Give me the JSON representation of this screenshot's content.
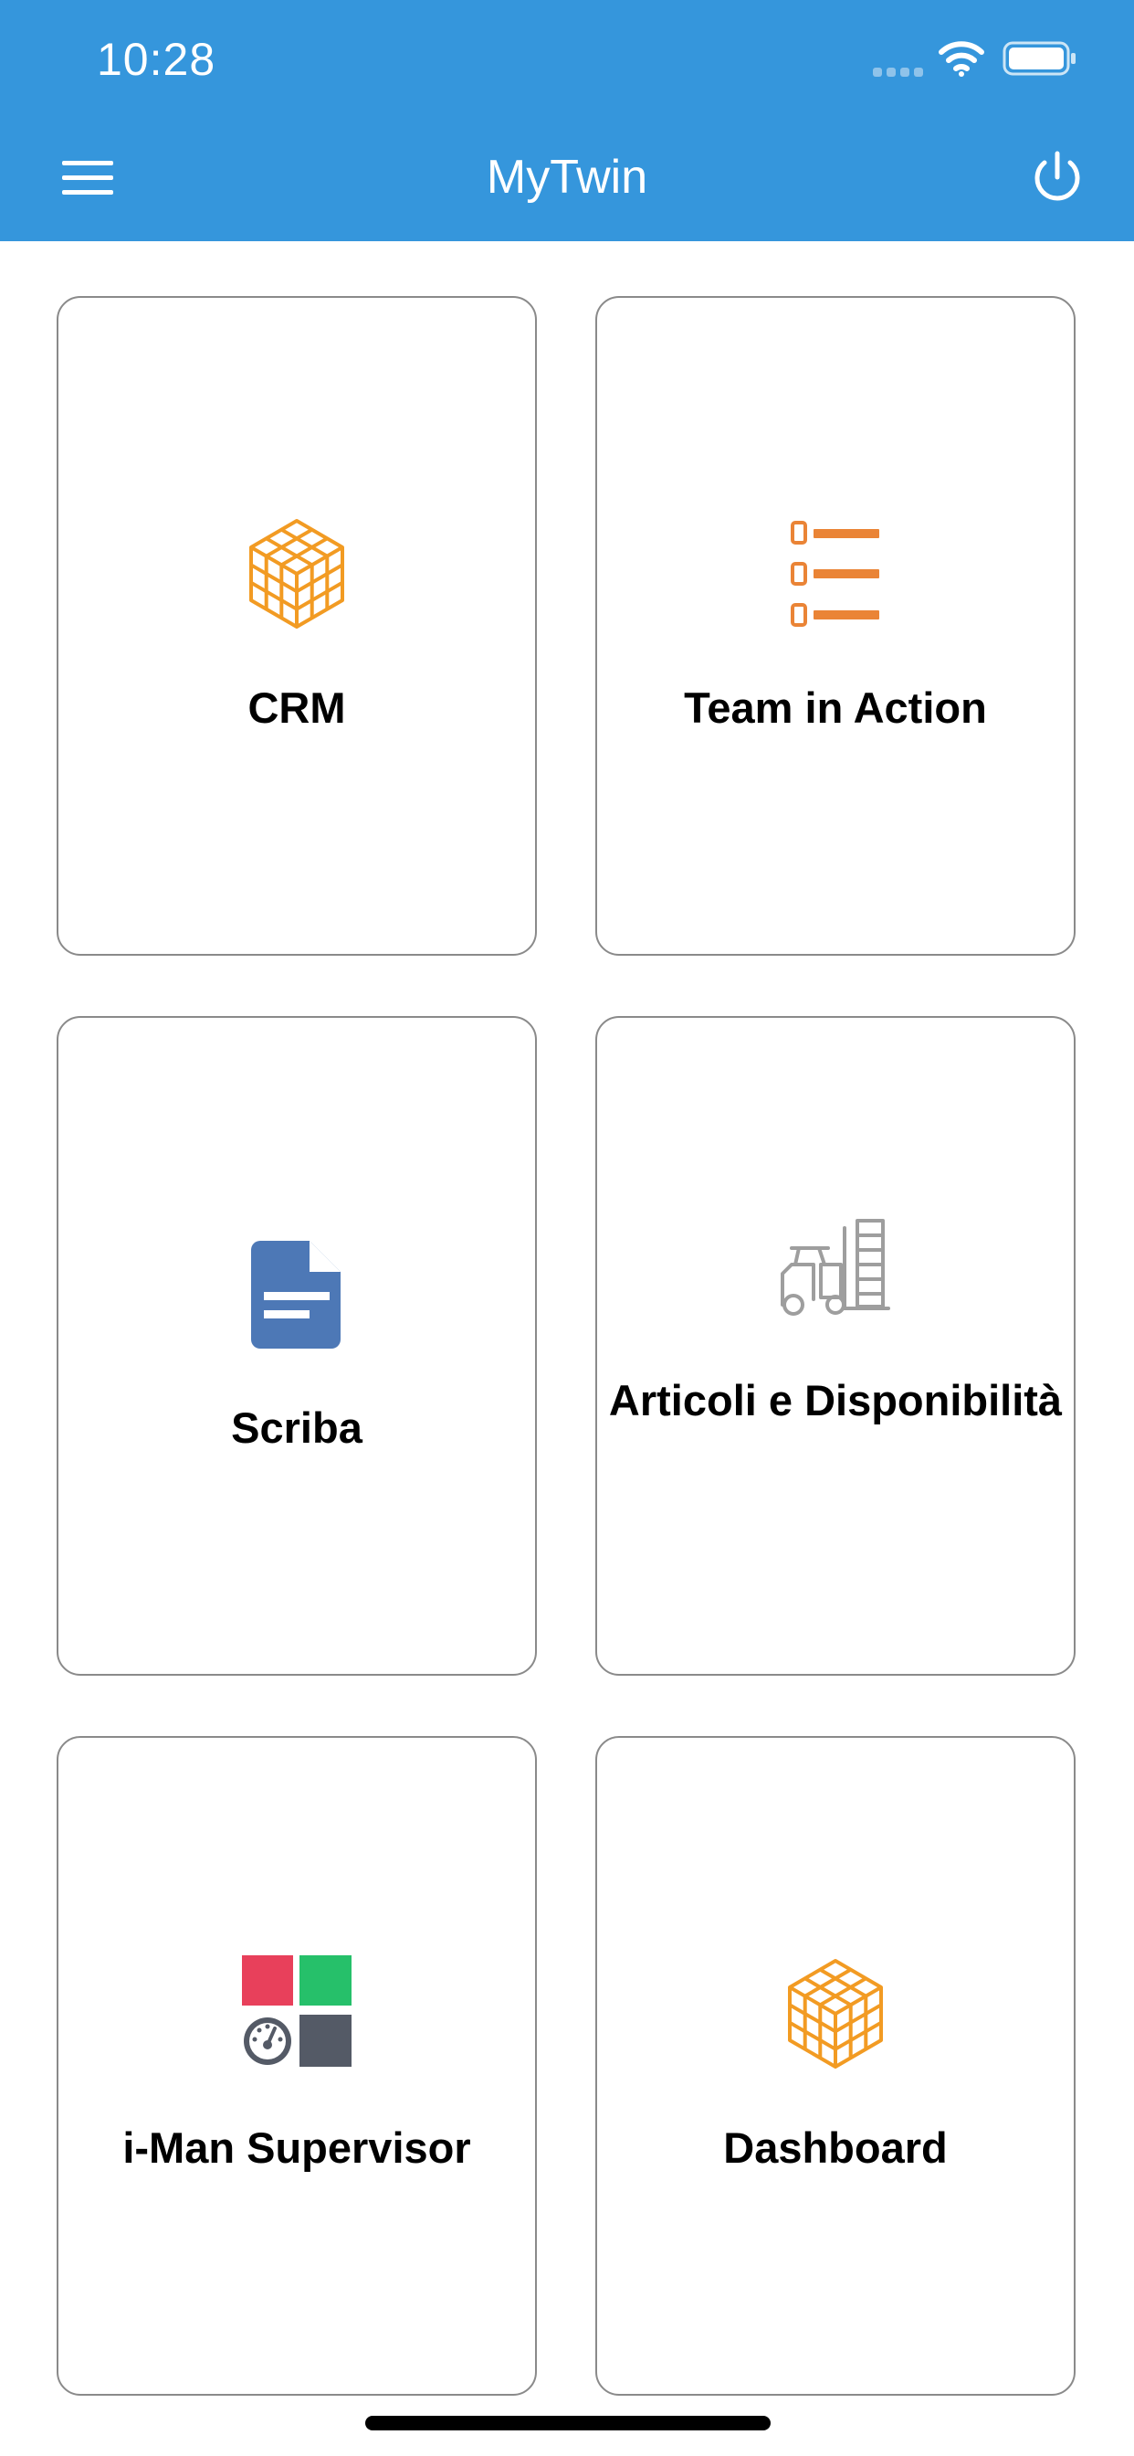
{
  "status_bar": {
    "time": "10:28",
    "icons": [
      "cellular-signal-icon",
      "wifi-icon",
      "battery-icon"
    ]
  },
  "header": {
    "title": "MyTwin",
    "left_icon": "hamburger-menu-icon",
    "right_icon": "power-icon",
    "background_color": "#3596dc"
  },
  "tiles": [
    {
      "label": "CRM",
      "icon": "cube-icon",
      "icon_color": "#f29b23"
    },
    {
      "label": "Team in Action",
      "icon": "checklist-icon",
      "icon_color": "#ea8436"
    },
    {
      "label": "Scriba",
      "icon": "document-icon",
      "icon_color": "#4d78b6"
    },
    {
      "label": "Articoli e Disponibilità",
      "icon": "forklift-icon",
      "icon_color": "#9e9e9e"
    },
    {
      "label": "i-Man Supervisor",
      "icon": "supervisor-grid-icon",
      "icon_colors": [
        "#e8405b",
        "#26c06a",
        "#545a66"
      ]
    },
    {
      "label": "Dashboard",
      "icon": "cube-icon",
      "icon_color": "#f29b23"
    }
  ]
}
